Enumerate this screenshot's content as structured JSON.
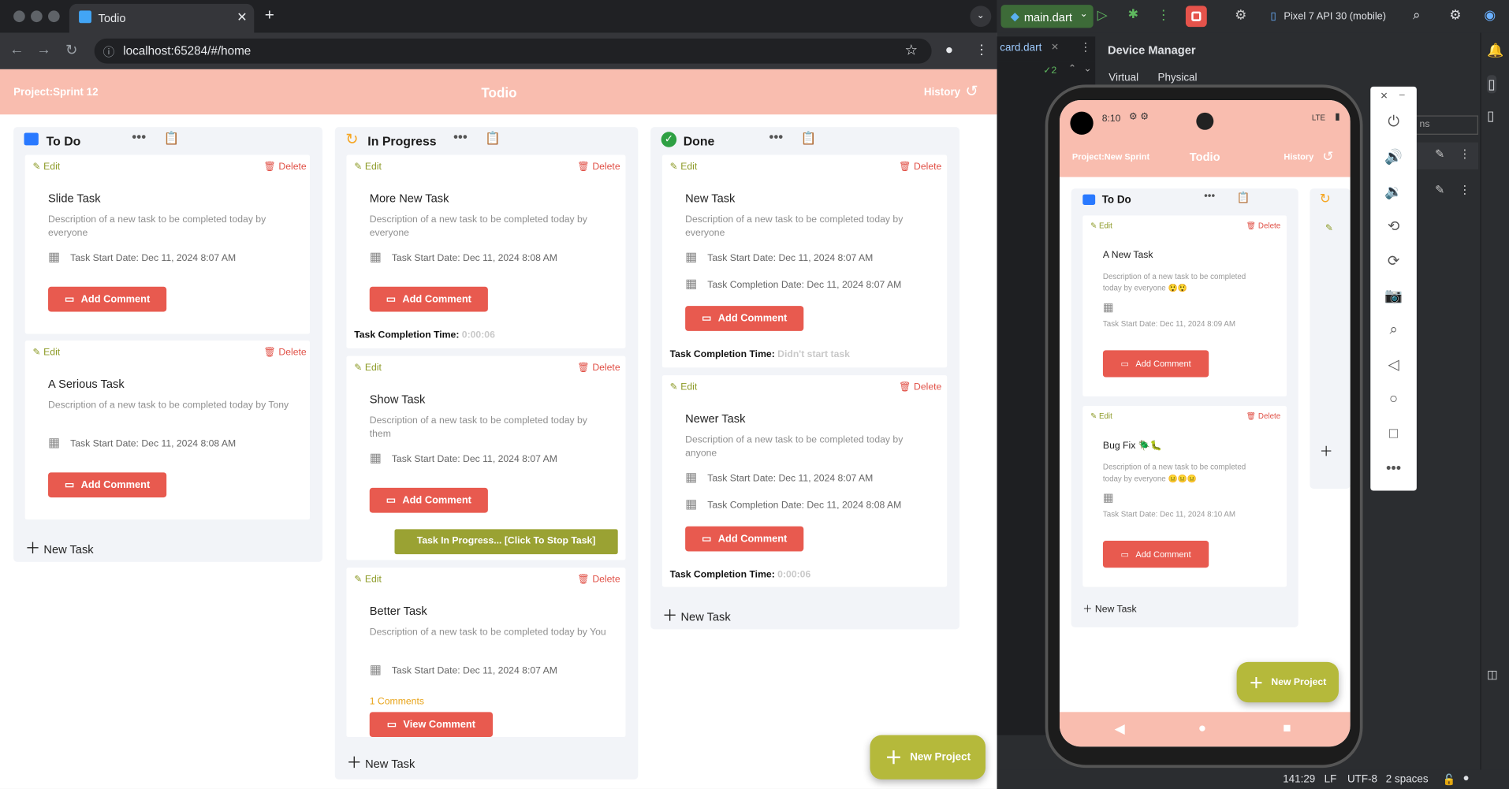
{
  "browser": {
    "tab_title": "Todio",
    "url": "localhost:65284/#/home"
  },
  "app": {
    "project": "Project:Sprint 12",
    "title": "Todio",
    "history": "History"
  },
  "columns": {
    "todo": {
      "title": "To Do"
    },
    "inprogress": {
      "title": "In Progress"
    },
    "done": {
      "title": "Done"
    }
  },
  "labels": {
    "edit": "Edit",
    "delete": "Delete",
    "add_comment": "Add Comment",
    "view_comment": "View Comment",
    "new_task": "New Task",
    "new_project": "New Project",
    "completion_time": "Task Completion Time:",
    "stop_task": "Task In Progress... [Click To Stop Task]"
  },
  "cards": {
    "t1": {
      "title": "Slide Task",
      "desc": "Description of a new task to be completed today by everyone",
      "start": "Task Start Date: Dec 11, 2024 8:07 AM"
    },
    "t2": {
      "title": "A Serious Task",
      "desc": "Description of a new task to be completed today by Tony",
      "start": "Task Start Date: Dec 11, 2024 8:08 AM"
    },
    "p1": {
      "title": "More New Task",
      "desc": "Description of a new task to be completed today by everyone",
      "start": "Task Start Date: Dec 11, 2024 8:08 AM",
      "ctime": "0:00:06"
    },
    "p2": {
      "title": "Show Task",
      "desc": "Description of a new task to be completed today by them",
      "start": "Task Start Date: Dec 11, 2024 8:07 AM"
    },
    "p3": {
      "title": "Better Task",
      "desc": "Description of a new task to be completed today by You",
      "start": "Task Start Date: Dec 11, 2024 8:07 AM",
      "comments": "1 Comments"
    },
    "d1": {
      "title": "New Task",
      "desc": "Description of a new task to be completed today by everyone",
      "start": "Task Start Date: Dec 11, 2024 8:07 AM",
      "complete": "Task Completion Date: Dec 11, 2024 8:07 AM",
      "ctime": "Didn't start task"
    },
    "d2": {
      "title": "Newer Task",
      "desc": "Description of a new task to be completed today by anyone",
      "start": "Task Start Date: Dec 11, 2024 8:07 AM",
      "complete": "Task Completion Date: Dec 11, 2024 8:08 AM",
      "ctime": "0:00:06"
    }
  },
  "ide": {
    "run_config": "main.dart",
    "device": "Pixel 7 API 30 (mobile)",
    "file_tab": "card.dart",
    "panel_title": "Device Manager",
    "tab_virtual": "Virtual",
    "tab_physical": "Physical",
    "warn_count": "2",
    "status": {
      "pos": "141:29",
      "le": "LF",
      "enc": "UTF-8",
      "indent": "2 spaces"
    },
    "partial": "ns"
  },
  "phone": {
    "time": "8:10",
    "signal": "LTE",
    "project": "Project:New Sprint",
    "title": "Todio",
    "history": "History",
    "column": "To Do",
    "new_task": "New Task",
    "new_project": "New Project",
    "c1": {
      "title": "A New Task",
      "desc": "Description of a new task to be completed today by everyone 😲😲",
      "start": "Task Start Date: Dec 11, 2024 8:09 AM"
    },
    "c2": {
      "title": "Bug Fix 🪲🐛",
      "desc": "Description of a new task to be completed today by everyone 😐😐😐",
      "start": "Task Start Date: Dec 11, 2024 8:10 AM"
    }
  }
}
